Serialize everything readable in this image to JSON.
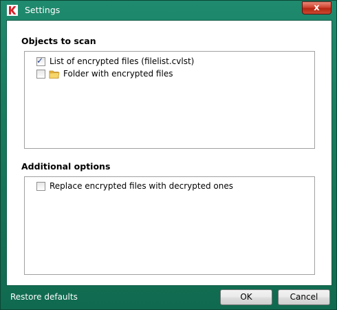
{
  "window": {
    "title": "Settings",
    "close_glyph": "x",
    "colors": {
      "frame": "#177a5d",
      "close": "#c84a30"
    }
  },
  "objects_to_scan": {
    "heading": "Objects to scan",
    "items": [
      {
        "label": "List of encrypted files (filelist.cvlst)",
        "checked": true,
        "checkmark": "✓",
        "icon": "none"
      },
      {
        "label": "Folder with encrypted files",
        "checked": false,
        "checkmark": "",
        "icon": "folder-icon"
      }
    ]
  },
  "additional_options": {
    "heading": "Additional options",
    "items": [
      {
        "label": "Replace encrypted files with decrypted ones",
        "checked": false,
        "checkmark": ""
      }
    ]
  },
  "footer": {
    "restore_label": "Restore defaults",
    "ok_label": "OK",
    "cancel_label": "Cancel"
  }
}
